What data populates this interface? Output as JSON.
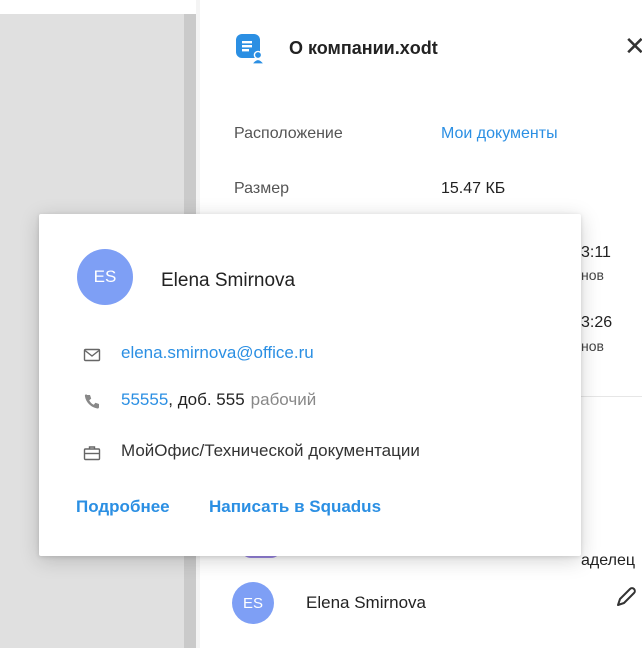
{
  "panel": {
    "file_name": "О компании.xodt",
    "location_label": "Расположение",
    "location_value": "Мои документы",
    "size_label": "Размер",
    "size_value": "15.47 КБ",
    "created_time_cut": "3:11",
    "created_by_cut": "нов",
    "modified_time_cut": "3:26",
    "modified_by_cut": "нов",
    "owner_label_cut": "аделец",
    "access_row": {
      "initials": "ES",
      "name": "Elena Smirnova"
    }
  },
  "card": {
    "initials": "ES",
    "name": "Elena Smirnova",
    "email": "elena.smirnova@office.ru",
    "phone_number": "55555",
    "phone_ext": ", доб. 555",
    "phone_type": "рабочий",
    "department": "МойОфис/Технической документации",
    "more_link": "Подробнее",
    "squadus_link": "Написать в Squadus"
  },
  "colors": {
    "accent": "#2b8fe3",
    "avatar": "#7e9ff5"
  }
}
